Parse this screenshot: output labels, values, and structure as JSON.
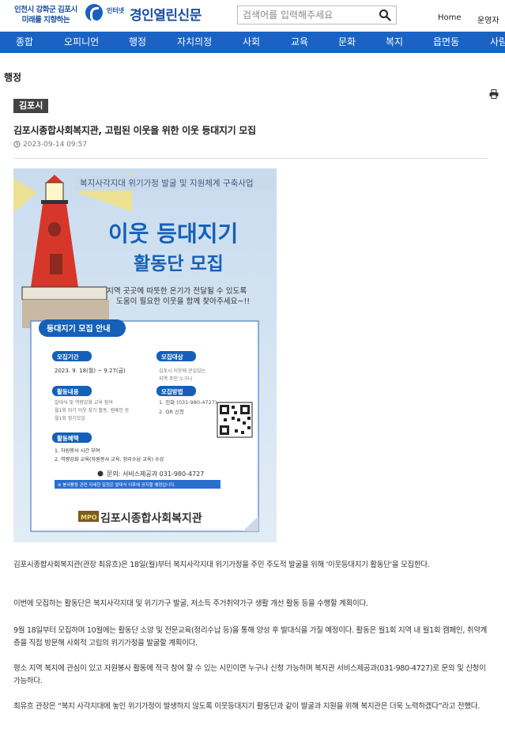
{
  "header": {
    "slogan_line1": "인천시 강화군 김포시",
    "slogan_line2": "미래를 지향하는",
    "logo_small": "인터넷",
    "logo_text": "경인열린신문",
    "search_placeholder": "검색어를 입력해주세요",
    "home_link": "Home",
    "admin_link": "운영자"
  },
  "nav": [
    "종합",
    "오피니언",
    "행정",
    "자치의정",
    "사회",
    "교육",
    "문화",
    "복지",
    "읍면동",
    "사람"
  ],
  "section": "행정",
  "article": {
    "category": "김포시",
    "title": "김포시종합사회복지관, 고립된 이웃을 위한 이웃 등대지기 모집",
    "date": "2023-09-14 09:57",
    "paragraphs": [
      "김포시종합사회복지관(관장 최유흐)은 18일(월)부터 복지사각지대 위기가정을 주민 주도적 발굴을 위해 '이웃등대지기 활동단'을 모집한다.",
      "이번에 모집하는 활동단은 복지사각지대 및 위기가구 발굴, 저소득 주거취약가구 생활 개선 활동 등을 수행할 계획이다.",
      "9월 18일부터 모집하며 10월에는 활동단 소양 및 전문교육(정리수납 등)을 통해 양성 후 발대식을 가질 예정이다. 활동은 월1회 지역 내 월1회 캠페인, 취약계층을 직접 방문해 사회적 고립의 위기가정을 발굴할 계획이다.",
      "평소 지역 복지에 관심이 있고 자원봉사 활동에 적극 참여 할 수 있는 시민이면 누구나 신청 가능하며 복지관 서비스제공과(031-980-4727)로 문의 및 신청이 가능하다.",
      "최유흐 관장은 “복지 사각지대에 놓인 위기가정이 발생하지 않도록 이웃등대지기 활동단과 같이 발굴과 지원을 위해 복지관은 더욱 노력하겠다”라고 전했다."
    ]
  },
  "poster": {
    "top_banner": "복지사각지대 위기가정 발굴 및 지원체계 구축사업",
    "title_line1": "이웃 등대지기",
    "title_line2": "활동단 모집",
    "subtitle_line1": "지역 곳곳에 따뜻한 온기가 전달될 수 있도록",
    "subtitle_line2": "도움이 필요한 이웃을 함께 찾아주세요~!!",
    "info_tab": "등대지기 모집 안내",
    "period_label": "모집기간",
    "period_value": "2023. 9. 18(월) ~ 9.27(금)",
    "target_label": "모집대상",
    "target_value1": "김포시 이웃에 관심있는",
    "target_value2": "지역 주민 누구나",
    "activity_label": "활동내용",
    "activity_value1": "발대식 및 역량강화 교육 참여",
    "activity_value2": "월1회 위기 이웃 찾기 활동, 캠페인 등",
    "activity_value3": "월1회 정기모임",
    "method_label": "모집방법",
    "method_value1": "1. 전화 (031-980-4727)",
    "method_value2": "2. QR 신청",
    "benefit_label": "활동혜택",
    "benefit_value1": "1. 자원봉사 시간 부여",
    "benefit_value2": "2. 역량강화 교육(자원봉사 교육, 정리수납 교육) 수강",
    "contact": "문의: 서비스제공과 031-980-4727",
    "notice": "※ 봉사활동 관련 자세한 일정은 발대식 이후에 공지할 예정입니다.",
    "org_badge": "MPO",
    "org_name": "김포시종합사회복지관"
  },
  "colors": {
    "nav_bg": "#1a63c4",
    "brand": "#1a4fa0",
    "poster_title": "#1560b8",
    "lighthouse_red": "#d7372a"
  }
}
